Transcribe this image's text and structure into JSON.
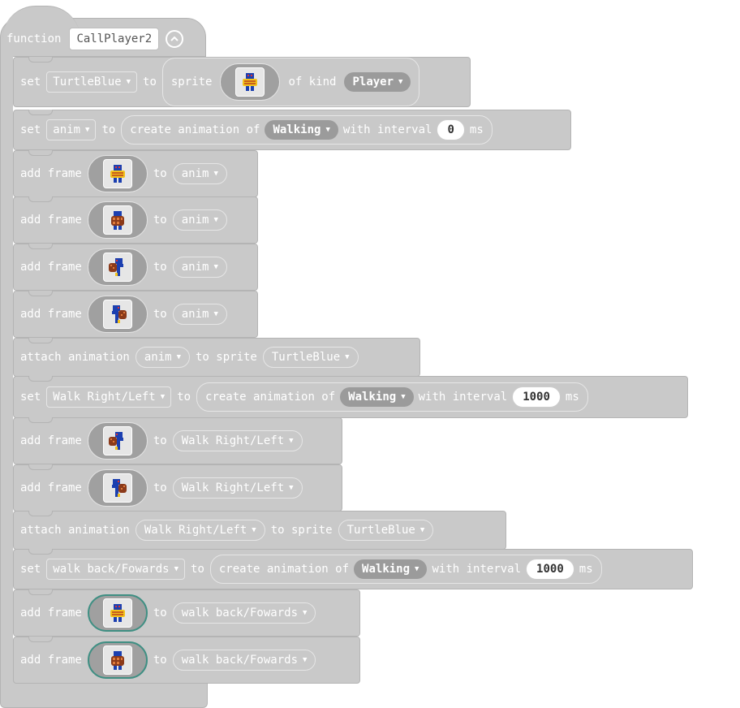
{
  "function": {
    "keyword": "function",
    "name": "CallPlayer2"
  },
  "blocks": [
    {
      "type": "set-sprite",
      "set": "set",
      "var": "TurtleBlue",
      "to": "to",
      "sprite": "sprite",
      "of_kind": "of kind",
      "kind": "Player",
      "frame": "front"
    },
    {
      "type": "set-anim",
      "set": "set",
      "var": "anim",
      "to": "to",
      "create": "create animation of",
      "action": "Walking",
      "with_interval": "with interval",
      "interval": "0",
      "ms": "ms"
    },
    {
      "type": "add-frame",
      "label": "add frame",
      "to": "to",
      "var": "anim",
      "frame": "front"
    },
    {
      "type": "add-frame",
      "label": "add frame",
      "to": "to",
      "var": "anim",
      "frame": "back"
    },
    {
      "type": "add-frame",
      "label": "add frame",
      "to": "to",
      "var": "anim",
      "frame": "left"
    },
    {
      "type": "add-frame",
      "label": "add frame",
      "to": "to",
      "var": "anim",
      "frame": "right"
    },
    {
      "type": "attach",
      "label": "attach animation",
      "var": "anim",
      "to_sprite": "to sprite",
      "sprite": "TurtleBlue"
    },
    {
      "type": "set-anim",
      "set": "set",
      "var": "Walk Right/Left",
      "to": "to",
      "create": "create animation of",
      "action": "Walking",
      "with_interval": "with interval",
      "interval": "1000",
      "ms": "ms"
    },
    {
      "type": "add-frame",
      "label": "add frame",
      "to": "to",
      "var": "Walk Right/Left",
      "frame": "left"
    },
    {
      "type": "add-frame",
      "label": "add frame",
      "to": "to",
      "var": "Walk Right/Left",
      "frame": "right"
    },
    {
      "type": "attach",
      "label": "attach animation",
      "var": "Walk Right/Left",
      "to_sprite": "to sprite",
      "sprite": "TurtleBlue"
    },
    {
      "type": "set-anim",
      "set": "set",
      "var": "walk back/Fowards",
      "to": "to",
      "create": "create animation of",
      "action": "Walking",
      "with_interval": "with interval",
      "interval": "1000",
      "ms": "ms"
    },
    {
      "type": "add-frame",
      "label": "add frame",
      "to": "to",
      "var": "walk back/Fowards",
      "frame": "front",
      "teal": true
    },
    {
      "type": "add-frame",
      "label": "add frame",
      "to": "to",
      "var": "walk back/Fowards",
      "frame": "back",
      "teal": true
    }
  ],
  "colors": {
    "block": "#c9c9c9",
    "dark_pill": "#9b9b9b",
    "teal_outline": "#3f8f83",
    "turtle_blue": "#1b3fb0",
    "shell_yellow": "#f2c21b",
    "shell_brown": "#8b3a1a"
  }
}
